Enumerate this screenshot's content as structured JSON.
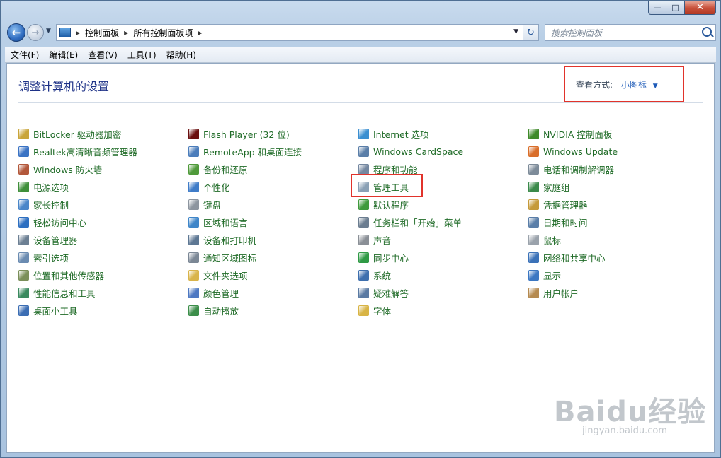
{
  "address": [
    "控制面板",
    "所有控制面板项"
  ],
  "search_placeholder": "搜索控制面板",
  "menu": [
    "文件(F)",
    "编辑(E)",
    "查看(V)",
    "工具(T)",
    "帮助(H)"
  ],
  "page_title": "调整计算机的设置",
  "view_by": {
    "label": "查看方式:",
    "value": "小图标"
  },
  "columns": [
    [
      {
        "label": "BitLocker 驱动器加密",
        "icon": "bitlocker-icon",
        "color": "#c9a53a"
      },
      {
        "label": "Realtek高清晰音频管理器",
        "icon": "realtek-audio-icon",
        "color": "#3a73c4"
      },
      {
        "label": "Windows 防火墙",
        "icon": "firewall-icon",
        "color": "#b2573a"
      },
      {
        "label": "电源选项",
        "icon": "power-icon",
        "color": "#3f8f3a"
      },
      {
        "label": "家长控制",
        "icon": "parental-control-icon",
        "color": "#4a86c9"
      },
      {
        "label": "轻松访问中心",
        "icon": "ease-of-access-icon",
        "color": "#2d6fc1"
      },
      {
        "label": "设备管理器",
        "icon": "device-manager-icon",
        "color": "#6c7f93"
      },
      {
        "label": "索引选项",
        "icon": "indexing-icon",
        "color": "#6a8bb1"
      },
      {
        "label": "位置和其他传感器",
        "icon": "location-sensor-icon",
        "color": "#7b8f5a"
      },
      {
        "label": "性能信息和工具",
        "icon": "performance-icon",
        "color": "#3a8a5f"
      },
      {
        "label": "桌面小工具",
        "icon": "gadgets-icon",
        "color": "#3b6db3"
      }
    ],
    [
      {
        "label": "Flash Player (32 位)",
        "icon": "flash-icon",
        "color": "#6b1010"
      },
      {
        "label": "RemoteApp 和桌面连接",
        "icon": "remoteapp-icon",
        "color": "#4b7dbb"
      },
      {
        "label": "备份和还原",
        "icon": "backup-icon",
        "color": "#4f9a3a"
      },
      {
        "label": "个性化",
        "icon": "personalization-icon",
        "color": "#3f7cc8"
      },
      {
        "label": "键盘",
        "icon": "keyboard-icon",
        "color": "#8d959f"
      },
      {
        "label": "区域和语言",
        "icon": "region-language-icon",
        "color": "#3f86c9"
      },
      {
        "label": "设备和打印机",
        "icon": "devices-printers-icon",
        "color": "#5d7793"
      },
      {
        "label": "通知区域图标",
        "icon": "notification-area-icon",
        "color": "#7b8795"
      },
      {
        "label": "文件夹选项",
        "icon": "folder-options-icon",
        "color": "#d9b44a"
      },
      {
        "label": "颜色管理",
        "icon": "color-management-icon",
        "color": "#4d78c2"
      },
      {
        "label": "自动播放",
        "icon": "autoplay-icon",
        "color": "#3c8e4a"
      }
    ],
    [
      {
        "label": "Internet 选项",
        "icon": "internet-options-icon",
        "color": "#3a8fd1"
      },
      {
        "label": "Windows CardSpace",
        "icon": "cardspace-icon",
        "color": "#5a7ea8"
      },
      {
        "label": "程序和功能",
        "icon": "programs-features-icon",
        "color": "#7487a0"
      },
      {
        "label": "管理工具",
        "icon": "admin-tools-icon",
        "color": "#8aa0b5"
      },
      {
        "label": "默认程序",
        "icon": "default-programs-icon",
        "color": "#3f9a3c"
      },
      {
        "label": "任务栏和「开始」菜单",
        "icon": "taskbar-start-icon",
        "color": "#6b7d90"
      },
      {
        "label": "声音",
        "icon": "sound-icon",
        "color": "#8a8f96"
      },
      {
        "label": "同步中心",
        "icon": "sync-center-icon",
        "color": "#2f9a45"
      },
      {
        "label": "系统",
        "icon": "system-icon",
        "color": "#3e6fae"
      },
      {
        "label": "疑难解答",
        "icon": "troubleshooting-icon",
        "color": "#5a7aa3"
      },
      {
        "label": "字体",
        "icon": "fonts-icon",
        "color": "#d8b445"
      }
    ],
    [
      {
        "label": "NVIDIA 控制面板",
        "icon": "nvidia-icon",
        "color": "#3f8a2a"
      },
      {
        "label": "Windows Update",
        "icon": "windows-update-icon",
        "color": "#d96e2a"
      },
      {
        "label": "电话和调制解调器",
        "icon": "phone-modem-icon",
        "color": "#7d8b99"
      },
      {
        "label": "家庭组",
        "icon": "homegroup-icon",
        "color": "#3a8a4a"
      },
      {
        "label": "凭据管理器",
        "icon": "credential-manager-icon",
        "color": "#c59a3a"
      },
      {
        "label": "日期和时间",
        "icon": "date-time-icon",
        "color": "#5a7ea8"
      },
      {
        "label": "鼠标",
        "icon": "mouse-icon",
        "color": "#9aa2ab"
      },
      {
        "label": "网络和共享中心",
        "icon": "network-sharing-icon",
        "color": "#3b72b8"
      },
      {
        "label": "显示",
        "icon": "display-icon",
        "color": "#3b77c2"
      },
      {
        "label": "用户帐户",
        "icon": "user-accounts-icon",
        "color": "#b58a50"
      }
    ]
  ],
  "highlight_color": "#e1332b",
  "link_color": "#1f6b27",
  "watermark": {
    "brand": "Baidu经验",
    "url": "jingyan.baidu.com"
  }
}
